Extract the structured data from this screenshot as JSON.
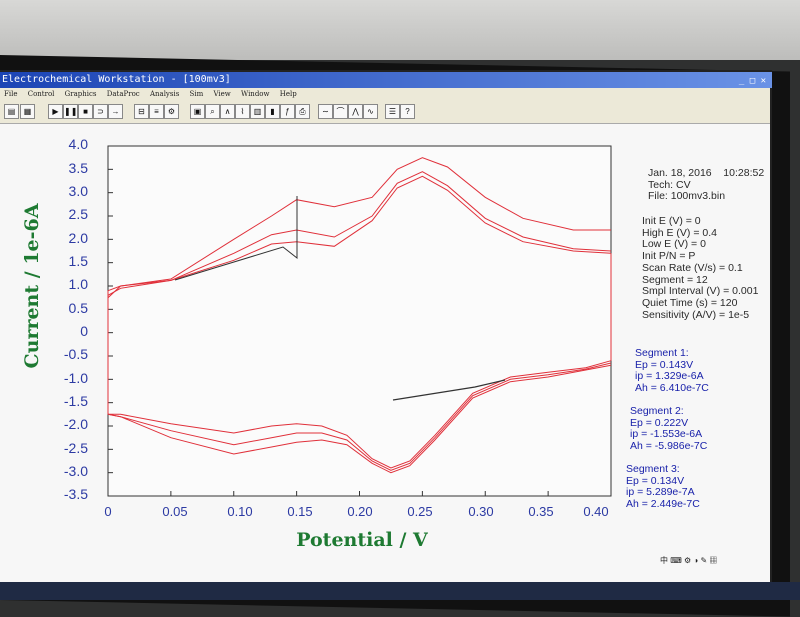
{
  "window": {
    "title": "Electrochemical Workstation - [100mv3]",
    "menus": [
      "File",
      "Control",
      "Graphics",
      "DataProc",
      "Analysis",
      "Sim",
      "View",
      "Window",
      "Help"
    ]
  },
  "info": {
    "date_time": "Jan. 18, 2016    10:28:52",
    "tech": "Tech: CV",
    "file": "File: 100mv3.bin",
    "params": [
      "Init E (V) = 0",
      "High E (V) = 0.4",
      "Low E (V) = 0",
      "Init P/N = P",
      "Scan Rate (V/s) = 0.1",
      "Segment = 12",
      "Smpl Interval (V) = 0.001",
      "Quiet Time (s) = 120",
      "Sensitivity (A/V) = 1e-5"
    ],
    "segments": [
      {
        "title": "Segment 1:",
        "ep": "Ep = 0.143V",
        "ip": "ip = 1.329e-6A",
        "ah": "Ah = 6.410e-7C"
      },
      {
        "title": "Segment 2:",
        "ep": "Ep = 0.222V",
        "ip": "ip = -1.553e-6A",
        "ah": "Ah = -5.986e-7C"
      },
      {
        "title": "Segment 3:",
        "ep": "Ep = 0.134V",
        "ip": "ip = 5.289e-7A",
        "ah": "Ah = 2.449e-7C"
      }
    ]
  },
  "chart_data": {
    "type": "line",
    "xlabel": "Potential / V",
    "ylabel": "Current / 1e-6A",
    "xlim": [
      0,
      0.4
    ],
    "ylim": [
      -3.5,
      4.0
    ],
    "x_ticks": [
      "0",
      "0.05",
      "0.10",
      "0.15",
      "0.20",
      "0.25",
      "0.30",
      "0.35",
      "0.40"
    ],
    "y_ticks": [
      "4.0",
      "3.5",
      "3.0",
      "2.5",
      "2.0",
      "1.5",
      "1.0",
      "0.5",
      "0",
      "-0.5",
      "-1.0",
      "-1.5",
      "-2.0",
      "-2.5",
      "-3.0",
      "-3.5"
    ],
    "colors": {
      "cv": "#e0303a",
      "baseline": "#222222"
    },
    "series": [
      {
        "x": [
          0,
          0.01,
          0.05,
          0.1,
          0.13,
          0.15,
          0.18,
          0.21,
          0.23,
          0.25,
          0.27,
          0.3,
          0.33,
          0.37,
          0.4
        ],
        "y": [
          0.9,
          1.0,
          1.12,
          1.55,
          1.9,
          1.95,
          1.85,
          2.4,
          3.1,
          3.35,
          3.05,
          2.35,
          1.95,
          1.75,
          1.7
        ]
      },
      {
        "x": [
          0.4,
          0.38,
          0.35,
          0.32,
          0.29,
          0.26,
          0.24,
          0.225,
          0.21,
          0.19,
          0.17,
          0.15,
          0.13,
          0.1,
          0.05,
          0.01,
          0
        ],
        "y": [
          -0.6,
          -0.75,
          -0.85,
          -0.95,
          -1.3,
          -2.2,
          -2.75,
          -2.9,
          -2.7,
          -2.2,
          -2.0,
          -1.95,
          -2.0,
          -2.15,
          -1.95,
          -1.75,
          -1.75
        ]
      },
      {
        "x": [
          0,
          0.01,
          0.05,
          0.1,
          0.13,
          0.15,
          0.18,
          0.21,
          0.23,
          0.25,
          0.27,
          0.3,
          0.33,
          0.37,
          0.4
        ],
        "y": [
          0.8,
          0.95,
          1.12,
          1.7,
          2.1,
          2.2,
          2.05,
          2.5,
          3.2,
          3.45,
          3.15,
          2.45,
          2.05,
          1.8,
          1.75
        ]
      },
      {
        "x": [
          0.4,
          0.38,
          0.35,
          0.32,
          0.29,
          0.26,
          0.24,
          0.225,
          0.21,
          0.19,
          0.17,
          0.15,
          0.13,
          0.1,
          0.05,
          0.01,
          0
        ],
        "y": [
          -0.65,
          -0.78,
          -0.9,
          -1.0,
          -1.35,
          -2.25,
          -2.8,
          -2.95,
          -2.75,
          -2.3,
          -2.15,
          -2.15,
          -2.25,
          -2.4,
          -2.1,
          -1.8,
          -1.75
        ]
      },
      {
        "x": [
          0,
          0.01,
          0.05,
          0.1,
          0.13,
          0.15,
          0.18,
          0.21,
          0.23,
          0.25,
          0.27,
          0.3,
          0.33,
          0.37,
          0.4
        ],
        "y": [
          0.75,
          1.0,
          1.15,
          2.0,
          2.5,
          2.85,
          2.7,
          2.9,
          3.5,
          3.75,
          3.55,
          2.9,
          2.45,
          2.2,
          2.2
        ]
      },
      {
        "x": [
          0.4,
          0.38,
          0.35,
          0.32,
          0.29,
          0.26,
          0.24,
          0.225,
          0.21,
          0.19,
          0.17,
          0.15,
          0.13,
          0.1,
          0.05,
          0.01,
          0
        ],
        "y": [
          -0.7,
          -0.8,
          -0.95,
          -1.05,
          -1.4,
          -2.3,
          -2.85,
          -3.0,
          -2.8,
          -2.4,
          -2.3,
          -2.35,
          -2.45,
          -2.6,
          -2.25,
          -1.8,
          -1.75
        ]
      }
    ]
  }
}
